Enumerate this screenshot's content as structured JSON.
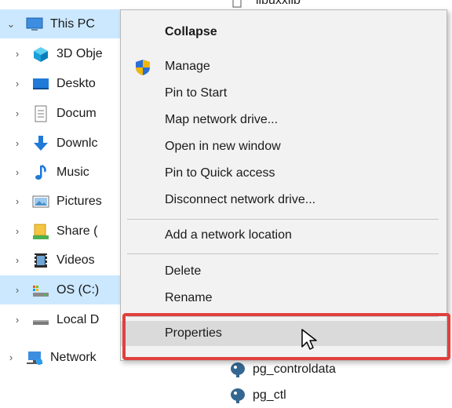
{
  "nav": {
    "items": [
      {
        "label": "This PC",
        "icon": "this-pc-icon",
        "expanded": true
      },
      {
        "label": "3D Obje",
        "icon": "3d-objects-icon"
      },
      {
        "label": "Deskto",
        "icon": "desktop-icon"
      },
      {
        "label": "Docum",
        "icon": "documents-icon"
      },
      {
        "label": "Downlc",
        "icon": "downloads-icon"
      },
      {
        "label": "Music",
        "icon": "music-icon"
      },
      {
        "label": "Pictures",
        "icon": "pictures-icon"
      },
      {
        "label": "Share (",
        "icon": "share-drive-icon"
      },
      {
        "label": "Videos",
        "icon": "videos-icon"
      },
      {
        "label": "OS (C:)",
        "icon": "os-drive-icon",
        "selected": true
      },
      {
        "label": "Local D",
        "icon": "local-disk-icon"
      },
      {
        "label": "Network",
        "icon": "network-icon"
      }
    ]
  },
  "files": {
    "top_partial": "libuxxlib",
    "rows": [
      {
        "label": "pg_controldata",
        "icon": "postgres-elephant-icon"
      },
      {
        "label": "pg_ctl",
        "icon": "postgres-elephant-icon"
      }
    ]
  },
  "context_menu": {
    "collapse": "Collapse",
    "manage": "Manage",
    "pin_to_start": "Pin to Start",
    "map_network_drive": "Map network drive...",
    "open_new_window": "Open in new window",
    "pin_quick_access": "Pin to Quick access",
    "disconnect_network_drive": "Disconnect network drive...",
    "add_network_location": "Add a network location",
    "delete": "Delete",
    "rename": "Rename",
    "properties": "Properties"
  },
  "colors": {
    "menu_bg": "#f2f2f2",
    "hover_bg": "#dadada",
    "selected_bg": "#cce8ff",
    "highlight_border": "#e0403e"
  }
}
